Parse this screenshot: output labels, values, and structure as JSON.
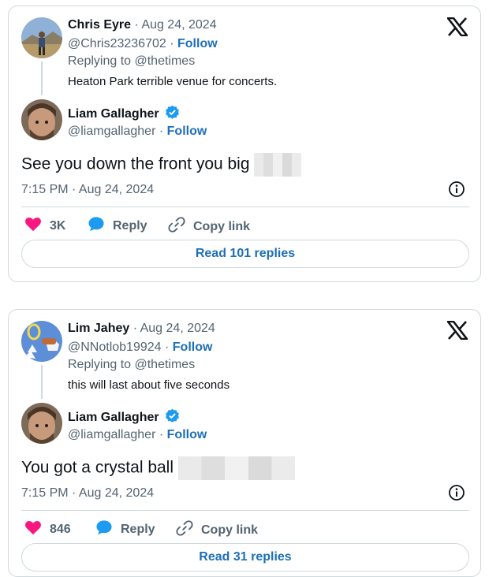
{
  "tweets": [
    {
      "parent": {
        "name": "Chris Eyre",
        "date": "Aug 24, 2024",
        "handle": "@Chris23236702",
        "follow": "Follow",
        "replying_to": "Replying to @thetimes",
        "text": "Heaton Park terrible venue for concerts."
      },
      "reply": {
        "name": "Liam Gallagher",
        "handle": "@liamgallagher",
        "follow": "Follow",
        "text": "See you down the front you big",
        "timestamp": "7:15 PM · Aug 24, 2024"
      },
      "likes": "3K",
      "reply_label": "Reply",
      "copy_link_label": "Copy link",
      "read_replies": "Read 101 replies"
    },
    {
      "parent": {
        "name": "Lim Jahey",
        "date": "Aug 24, 2024",
        "handle": "@NNotlob19924",
        "follow": "Follow",
        "replying_to": "Replying to @thetimes",
        "text": "this will last about five seconds"
      },
      "reply": {
        "name": "Liam Gallagher",
        "handle": "@liamgallagher",
        "follow": "Follow",
        "text": "You got a crystal ball",
        "timestamp": "7:15 PM · Aug 24, 2024"
      },
      "likes": "846",
      "reply_label": "Reply",
      "copy_link_label": "Copy link",
      "read_replies": "Read 31 replies"
    }
  ],
  "colors": {
    "accent": "#1d6fb8",
    "heart": "#f91880",
    "reply_bubble": "#1d9bf0",
    "verified": "#1d9bf0",
    "border": "#cfd9de",
    "muted": "#536471"
  },
  "icons": [
    "x-logo-icon",
    "verified-badge-icon",
    "info-icon",
    "heart-icon",
    "reply-bubble-icon",
    "link-icon"
  ]
}
